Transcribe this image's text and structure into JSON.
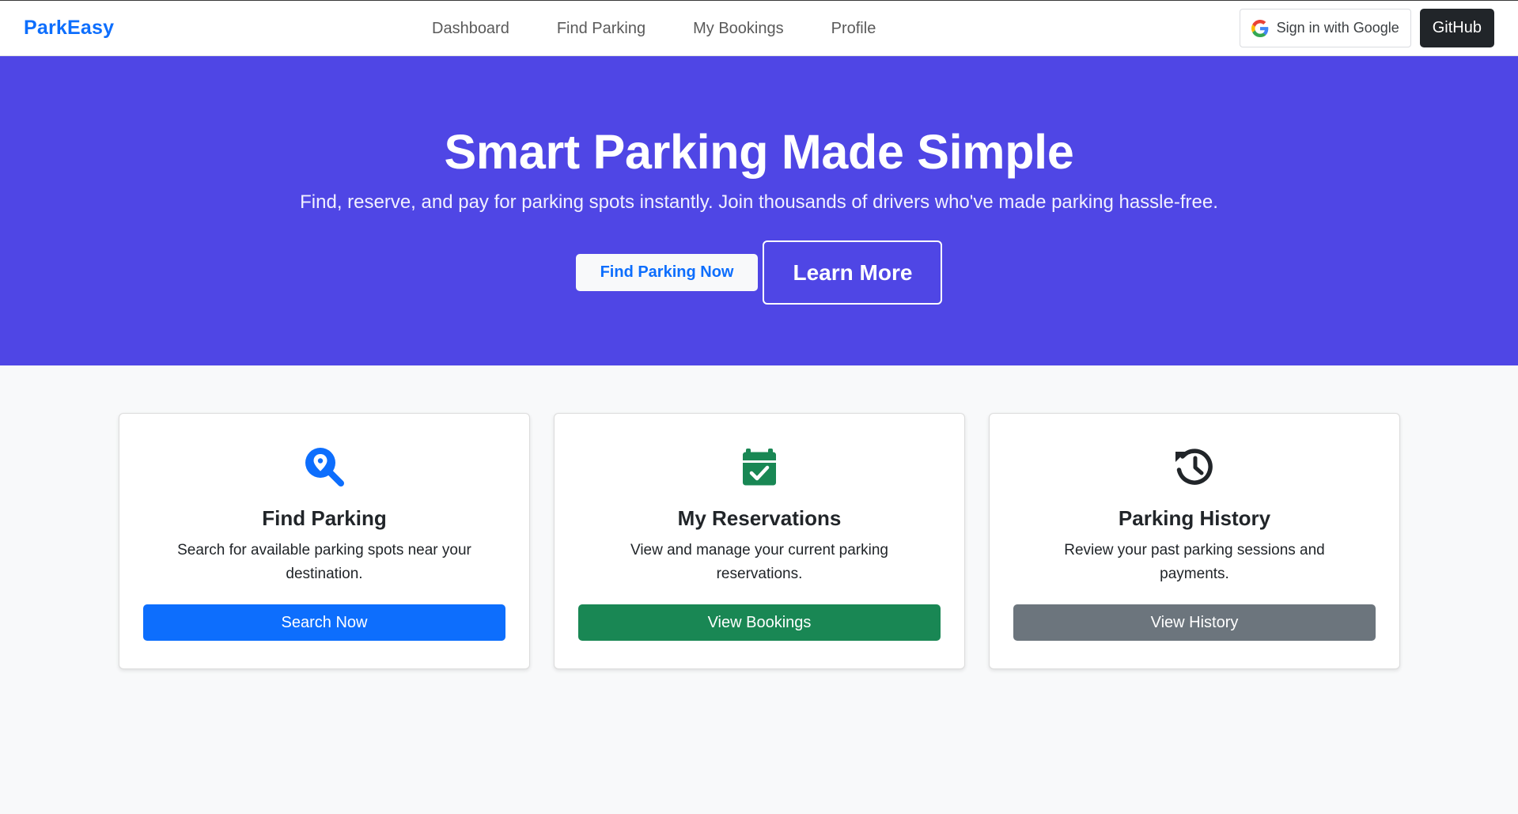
{
  "navbar": {
    "brand": "ParkEasy",
    "links": [
      "Dashboard",
      "Find Parking",
      "My Bookings",
      "Profile"
    ],
    "google_label": "Sign in with Google",
    "github_label": "GitHub"
  },
  "hero": {
    "title": "Smart Parking Made Simple",
    "subtitle": "Find, reserve, and pay for parking spots instantly. Join thousands of drivers who've made parking hassle-free.",
    "primary_button": "Find Parking Now",
    "secondary_button": "Learn More"
  },
  "cards": [
    {
      "icon": "search-location-icon",
      "title": "Find Parking",
      "text": "Search for available parking spots near your destination.",
      "button": "Search Now"
    },
    {
      "icon": "calendar-check-icon",
      "title": "My Reservations",
      "text": "View and manage your current parking reservations.",
      "button": "View Bookings"
    },
    {
      "icon": "history-icon",
      "title": "Parking History",
      "text": "Review your past parking sessions and payments.",
      "button": "View History"
    }
  ],
  "colors": {
    "brand": "#0d6efd",
    "hero_bg": "#4f46e5",
    "success": "#198754",
    "secondary": "#6c757d",
    "dark": "#212529"
  }
}
